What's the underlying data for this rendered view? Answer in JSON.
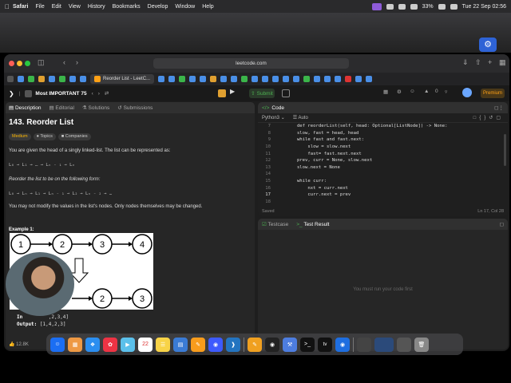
{
  "menubar": {
    "app": "Safari",
    "items": [
      "File",
      "Edit",
      "View",
      "History",
      "Bookmarks",
      "Develop",
      "Window",
      "Help"
    ],
    "battery": "33%",
    "datetime": "Tue 22 Sep  02:56"
  },
  "browser": {
    "url": "leetcode.com",
    "active_tab": "Reorder List - LeetC..."
  },
  "lc": {
    "list_name": "Most IMPORTANT 75",
    "submit": "Submit",
    "premium": "Premium"
  },
  "problem": {
    "tabs": [
      "Description",
      "Editorial",
      "Solutions",
      "Submissions"
    ],
    "title": "143. Reorder List",
    "difficulty": "Medium",
    "topics": "Topics",
    "companies": "Companies",
    "p1": "You are given the head of a singly linked-list. The list can be represented as:",
    "list1": "L₀ → L₁ → … → Lₙ ₋ ₁ → Lₙ",
    "p2": "Reorder the list to be on the following form:",
    "list2": "L₀ → Lₙ → L₁ → Lₙ ₋ ₁ → L₂ → Lₙ ₋ ₂ → …",
    "p3": "You may not modify the values in the list's nodes. Only nodes themselves may be changed.",
    "example": "Example 1:",
    "nodes_top": [
      "1",
      "2",
      "3",
      "4"
    ],
    "nodes_bottom": [
      "2",
      "3"
    ],
    "input_label": "In",
    "input_value": ",2,3,4]",
    "output_label": "Output:",
    "output_value": "[1,4,2,3]",
    "likes": "12.8K"
  },
  "editor": {
    "header": "Code",
    "language": "Python3",
    "mode": "Auto",
    "lines": [
      {
        "n": "7",
        "text": "        def reorderList(self, head: Optional[ListNode]) -> None:"
      },
      {
        "n": "8",
        "text": "        slow, fast = head, head"
      },
      {
        "n": "9",
        "text": "        while fast and fast.next:"
      },
      {
        "n": "10",
        "text": "            slow = slow.next"
      },
      {
        "n": "11",
        "text": "            fast= fast.next.next"
      },
      {
        "n": "12",
        "text": "        prev, curr = None, slow.next"
      },
      {
        "n": "13",
        "text": "        slow.next = None"
      },
      {
        "n": "14",
        "text": ""
      },
      {
        "n": "15",
        "text": "        while curr:"
      },
      {
        "n": "16",
        "text": "            nxt = curr.next"
      },
      {
        "n": "17",
        "text": "            curr.next = prev"
      },
      {
        "n": "18",
        "text": ""
      }
    ],
    "status": "Saved",
    "cursor": "Ln 17, Col 28"
  },
  "testpanel": {
    "tabs": [
      "Testcase",
      "Test Result"
    ],
    "message": "You must run your code first"
  },
  "dock": {
    "calendar_day": "22",
    "appletv": "tv"
  }
}
